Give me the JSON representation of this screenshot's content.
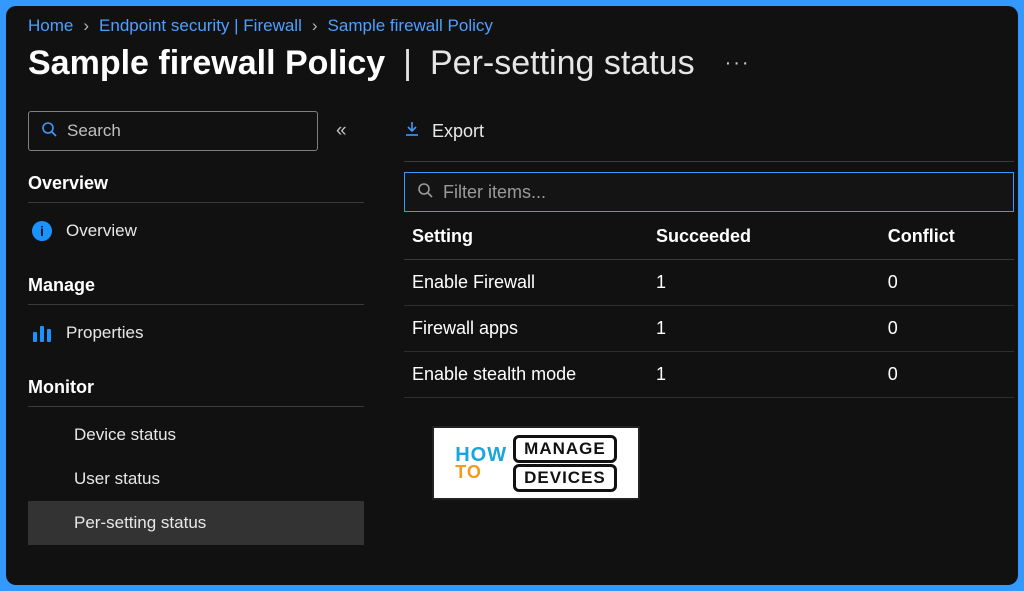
{
  "breadcrumb": {
    "items": [
      "Home",
      "Endpoint security | Firewall",
      "Sample firewall Policy"
    ]
  },
  "title": {
    "name": "Sample firewall Policy",
    "section": "Per-setting status",
    "more": "···"
  },
  "sidebar": {
    "search_placeholder": "Search",
    "collapse_glyph": "«",
    "groups": {
      "overview": {
        "label": "Overview",
        "items": [
          {
            "label": "Overview"
          }
        ]
      },
      "manage": {
        "label": "Manage",
        "items": [
          {
            "label": "Properties"
          }
        ]
      },
      "monitor": {
        "label": "Monitor",
        "items": [
          {
            "label": "Device status"
          },
          {
            "label": "User status"
          },
          {
            "label": "Per-setting status"
          }
        ]
      }
    }
  },
  "toolbar": {
    "export_label": "Export"
  },
  "filter": {
    "placeholder": "Filter items..."
  },
  "table": {
    "columns": [
      "Setting",
      "Succeeded",
      "Conflict"
    ],
    "rows": [
      {
        "setting": "Enable Firewall",
        "succeeded": "1",
        "conflict": "0"
      },
      {
        "setting": "Firewall apps",
        "succeeded": "1",
        "conflict": "0"
      },
      {
        "setting": "Enable stealth mode",
        "succeeded": "1",
        "conflict": "0"
      }
    ]
  },
  "logo": {
    "how": "HOW",
    "to": "TO",
    "line1": "MANAGE",
    "line2": "DEVICES"
  }
}
